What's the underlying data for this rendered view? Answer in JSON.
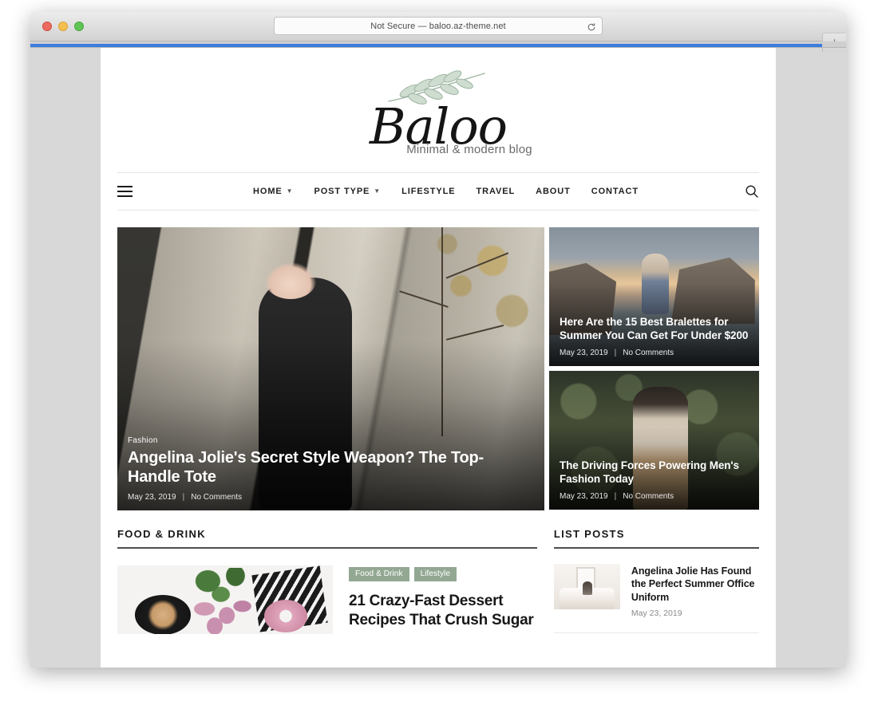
{
  "browser": {
    "url_text": "Not Secure — baloo.az-theme.net",
    "reload_icon": "reload-icon",
    "new_tab_label": "+",
    "traffic_lights": [
      "close",
      "minimize",
      "zoom"
    ]
  },
  "site": {
    "logo_text": "Baloo",
    "tagline": "Minimal & modern blog",
    "leaf_icon": "leaf-branch-icon",
    "menu_icon": "hamburger-menu-icon",
    "search_icon": "search-icon"
  },
  "nav": {
    "items": [
      {
        "label": "HOME",
        "has_dropdown": true
      },
      {
        "label": "POST TYPE",
        "has_dropdown": true
      },
      {
        "label": "LIFESTYLE",
        "has_dropdown": false
      },
      {
        "label": "TRAVEL",
        "has_dropdown": false
      },
      {
        "label": "ABOUT",
        "has_dropdown": false
      },
      {
        "label": "CONTACT",
        "has_dropdown": false
      }
    ]
  },
  "featured": {
    "main": {
      "category": "Fashion",
      "title": "Angelina Jolie's Secret Style Weapon? The Top-Handle Tote",
      "date": "May 23, 2019",
      "comments": "No Comments",
      "separator": "|"
    },
    "side": [
      {
        "title": "Here Are the 15 Best Bralettes for Summer You Can Get For Under $200",
        "date": "May 23, 2019",
        "comments": "No Comments",
        "separator": "|"
      },
      {
        "title": "The Driving Forces Powering Men's Fashion Today",
        "date": "May 23, 2019",
        "comments": "No Comments",
        "separator": "|"
      }
    ]
  },
  "food_drink": {
    "heading": "FOOD & DRINK",
    "post": {
      "tags": [
        "Food & Drink",
        "Lifestyle"
      ],
      "title": "21 Crazy-Fast Dessert Recipes That Crush Sugar"
    }
  },
  "list_posts": {
    "heading": "LIST POSTS",
    "items": [
      {
        "title": "Angelina Jolie Has Found the Perfect Summer Office Uniform",
        "date": "May 23, 2019"
      }
    ]
  },
  "colors": {
    "tag_background": "#93a893",
    "section_rule": "#4d4d4d",
    "text_primary": "#171717",
    "text_muted": "#8a8a8a",
    "active_tab": "#3b7ddd"
  }
}
